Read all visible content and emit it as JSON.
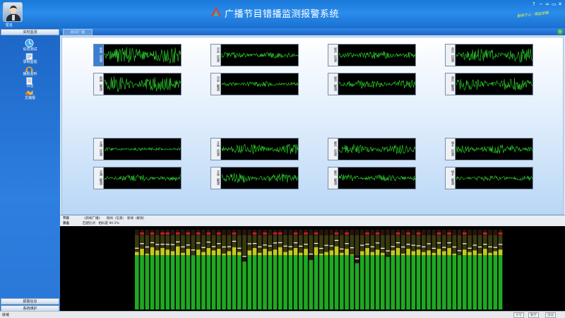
{
  "user": {
    "name": "匿名"
  },
  "header": {
    "title": "广播节目错播监测报警系统",
    "slogan": "勤修于心 · 精益求精"
  },
  "window_controls": [
    {
      "icon": "help-icon",
      "glyph": "?"
    },
    {
      "icon": "minimize-icon",
      "glyph": "−"
    },
    {
      "icon": "wifi-icon",
      "glyph": "≈"
    },
    {
      "icon": "restore-icon",
      "glyph": "▭"
    },
    {
      "icon": "close-icon",
      "glyph": "✕"
    }
  ],
  "sidebar": {
    "top_header": "实时监测",
    "items": [
      {
        "label": "动态测试",
        "icon": "dynamic-test-icon"
      },
      {
        "label": "录制监视",
        "icon": "record-monitor-icon"
      },
      {
        "label": "播报监听",
        "icon": "headphones-icon"
      },
      {
        "label": "日志",
        "icon": "log-icon"
      },
      {
        "label": "文播报",
        "icon": "broadcast-icon"
      }
    ],
    "bottom_headers": [
      "报警信息",
      "系统维护"
    ]
  },
  "tab": {
    "label": "新闻广播"
  },
  "monitors": [
    {
      "label": "新闻（信源）",
      "amp": 0.9,
      "active": true
    },
    {
      "label": "中央（信源）",
      "amp": 0.35
    },
    {
      "label": "经济（信源）",
      "amp": 0.45
    },
    {
      "label": "音乐（信源）",
      "amp": 0.8
    },
    {
      "label": "新闻（解调）",
      "amp": 0.85
    },
    {
      "label": "中央（解调）",
      "amp": 0.3
    },
    {
      "label": "经济（解调）",
      "amp": 0.5
    },
    {
      "label": "音乐（解调）",
      "amp": 0.7
    },
    {
      "label": "交通（信源）",
      "amp": 0.2
    },
    {
      "label": "文体（信源）",
      "amp": 0.55
    },
    {
      "label": "都市（信源）",
      "amp": 0.5
    },
    {
      "label": "城乡（信源）",
      "amp": 0.5
    },
    {
      "label": "交通（解调）",
      "amp": 0.35
    },
    {
      "label": "文体（解调）",
      "amp": 0.55
    },
    {
      "label": "都市（解调）",
      "amp": 0.4
    },
    {
      "label": "城乡（解调）",
      "amp": 0.3
    }
  ],
  "info": {
    "program_label": "节目",
    "program_value": "《新闻广播》　　新闻（信源）　新闻（解调）",
    "status_label": "状态",
    "status_value": "匹配比对　相似度 90.5%"
  },
  "meter": {
    "levels": [
      0.72,
      0.76,
      0.7,
      0.78,
      0.74,
      0.77,
      0.75,
      0.73,
      0.79,
      0.71,
      0.76,
      0.68,
      0.75,
      0.72,
      0.77,
      0.74,
      0.76,
      0.7,
      0.73,
      0.78,
      0.72,
      0.6,
      0.74,
      0.77,
      0.71,
      0.76,
      0.73,
      0.75,
      0.78,
      0.72,
      0.74,
      0.77,
      0.71,
      0.76,
      0.62,
      0.78,
      0.7,
      0.72,
      0.74,
      0.79,
      0.71,
      0.76,
      0.69,
      0.58,
      0.73,
      0.77,
      0.72,
      0.75,
      0.71,
      0.66,
      0.74,
      0.77,
      0.7,
      0.76,
      0.73,
      0.75,
      0.72,
      0.74,
      0.71,
      0.76,
      0.73,
      0.77,
      0.7,
      0.68,
      0.75,
      0.72,
      0.74,
      0.7,
      0.76,
      0.71,
      0.73,
      0.75
    ],
    "colors": {
      "green": "#1fa822",
      "yellow": "#c8c81e",
      "red": "#c81e1e",
      "peak": "#ffffff"
    }
  },
  "statusbar": {
    "left": "就绪",
    "items": [
      "大写",
      "数字",
      "滚动"
    ]
  }
}
